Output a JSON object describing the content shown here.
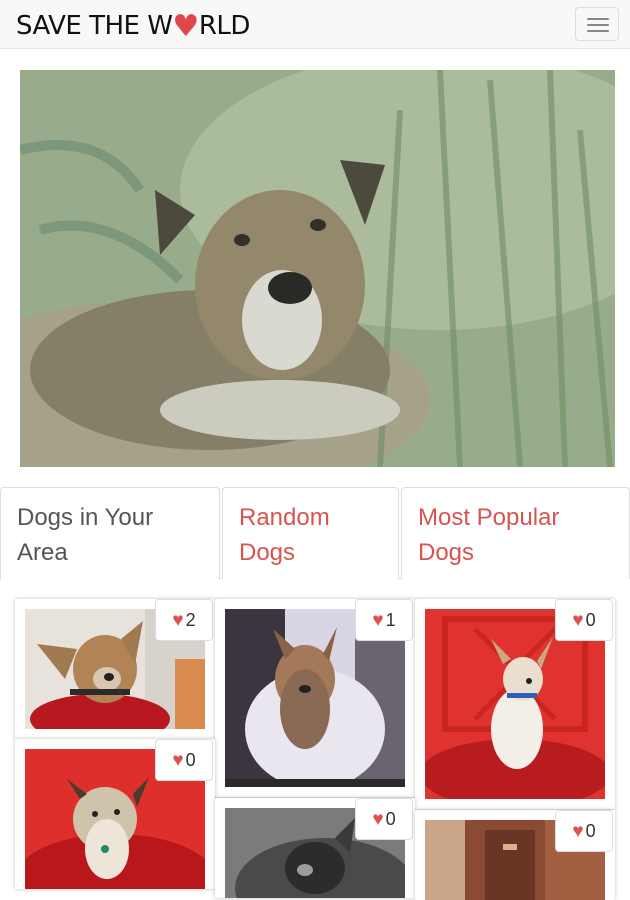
{
  "brand": {
    "prefix": "SAVE THE W",
    "heart": "♥",
    "suffix": "RLD"
  },
  "nav": {
    "toggle_icon": "hamburger-icon"
  },
  "tabs": [
    {
      "label": "Dogs in Your Area",
      "active": true
    },
    {
      "label": "Random Dogs",
      "active": false
    },
    {
      "label": "Most Popular Dogs",
      "active": false
    }
  ],
  "colors": {
    "accent": "#d9534f",
    "heart": "#e0474c",
    "active_tab_text": "#555555"
  },
  "cards": [
    {
      "likes": "2",
      "heart": "♥"
    },
    {
      "likes": "1",
      "heart": "♥"
    },
    {
      "likes": "0",
      "heart": "♥"
    },
    {
      "likes": "0",
      "heart": "♥"
    },
    {
      "likes": "0",
      "heart": "♥"
    },
    {
      "likes": "0",
      "heart": "♥"
    }
  ]
}
